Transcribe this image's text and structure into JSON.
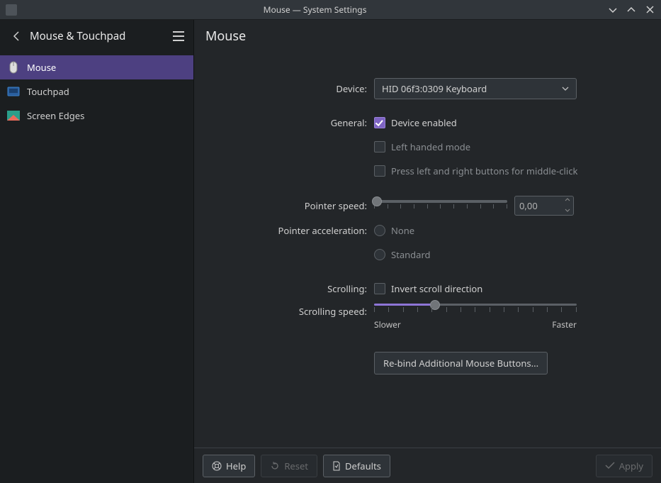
{
  "window": {
    "title": "Mouse — System Settings"
  },
  "sidebar": {
    "title": "Mouse & Touchpad",
    "items": [
      {
        "label": "Mouse",
        "active": true
      },
      {
        "label": "Touchpad",
        "active": false
      },
      {
        "label": "Screen Edges",
        "active": false
      }
    ]
  },
  "main": {
    "title": "Mouse"
  },
  "form": {
    "device_label": "Device:",
    "device_value": "HID 06f3:0309 Keyboard",
    "general_label": "General:",
    "device_enabled": {
      "label": "Device enabled",
      "checked": true
    },
    "left_handed": {
      "label": "Left handed mode",
      "checked": false
    },
    "middle_click": {
      "label": "Press left and right buttons for middle-click",
      "checked": false
    },
    "pointer_speed_label": "Pointer speed:",
    "pointer_speed_value": "0,00",
    "pointer_speed_pct": 0,
    "pointer_accel_label": "Pointer acceleration:",
    "accel_none": "None",
    "accel_standard": "Standard",
    "scrolling_label": "Scrolling:",
    "invert_scroll": {
      "label": "Invert scroll direction",
      "checked": false
    },
    "scrolling_speed_label": "Scrolling speed:",
    "scrolling_speed_pct": 30,
    "slower": "Slower",
    "faster": "Faster",
    "rebind": "Re-bind Additional Mouse Buttons..."
  },
  "footer": {
    "help": "Help",
    "reset": "Reset",
    "defaults": "Defaults",
    "apply": "Apply"
  }
}
